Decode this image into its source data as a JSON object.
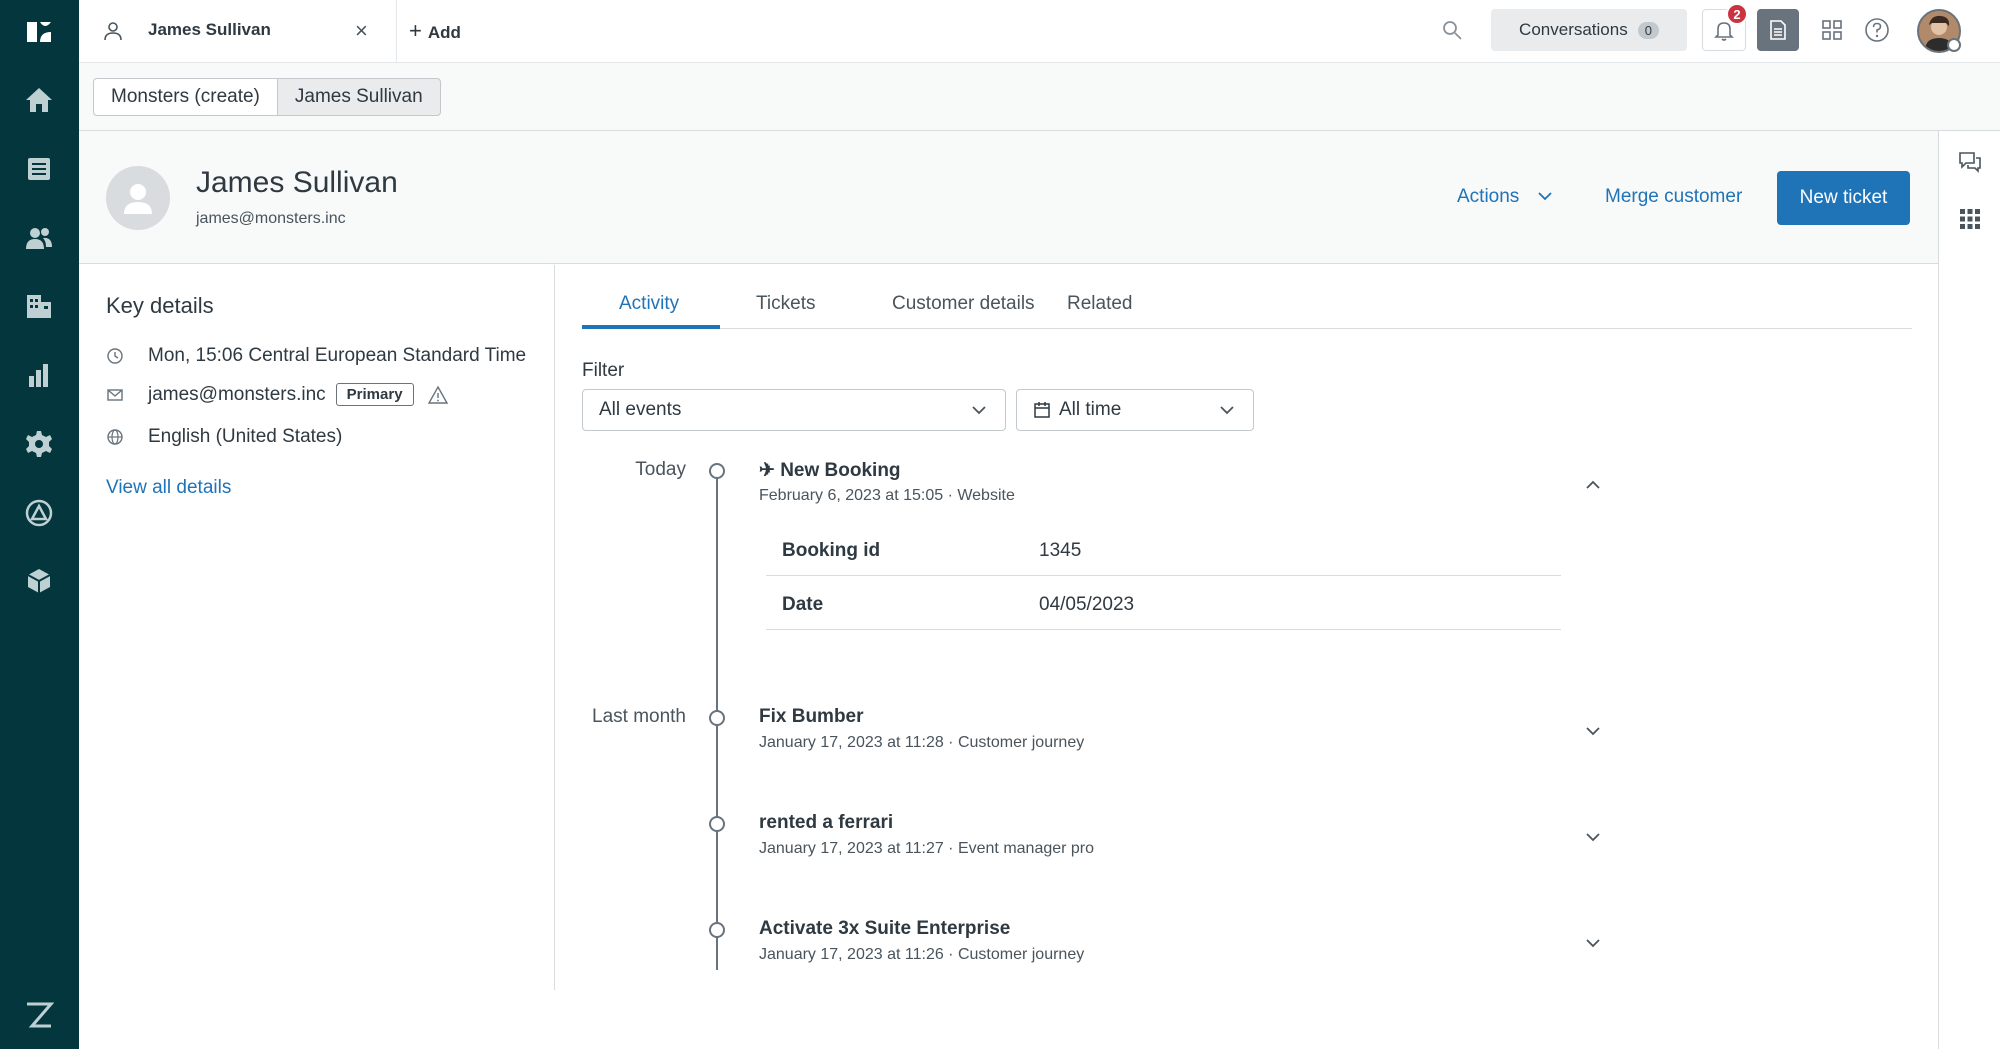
{
  "topbar": {
    "tab_label": "James Sullivan",
    "add_label": "Add",
    "conversations_label": "Conversations",
    "conversations_count": "0",
    "notifications_count": "2"
  },
  "breadcrumb": {
    "items": [
      "Monsters (create)",
      "James Sullivan"
    ]
  },
  "customer": {
    "name": "James Sullivan",
    "email": "james@monsters.inc"
  },
  "header_actions": {
    "actions_label": "Actions",
    "merge_label": "Merge customer",
    "new_ticket_label": "New ticket"
  },
  "key_details": {
    "title": "Key details",
    "time": "Mon, 15:06 Central European Standard Time",
    "email": "james@monsters.inc",
    "primary_tag": "Primary",
    "language": "English (United States)",
    "view_all": "View all details"
  },
  "tabs": [
    "Activity",
    "Tickets",
    "Customer details",
    "Related"
  ],
  "filter": {
    "label": "Filter",
    "events_value": "All events",
    "time_value": "All time"
  },
  "timeline": {
    "group_today": "Today",
    "group_last_month": "Last month",
    "events": [
      {
        "title": "✈ New Booking",
        "sub": "February 6, 2023 at 15:05 · Website"
      },
      {
        "title": "Fix Bumber",
        "sub": "January 17, 2023 at 11:28 · Customer journey"
      },
      {
        "title": "rented a ferrari",
        "sub": "January 17, 2023 at 11:27 · Event manager pro"
      },
      {
        "title": "Activate 3x Suite Enterprise",
        "sub": "January 17, 2023 at 11:26 · Customer journey"
      }
    ],
    "booking_details": [
      {
        "key": "Booking id",
        "value": "1345"
      },
      {
        "key": "Date",
        "value": "04/05/2023"
      }
    ]
  },
  "colors": {
    "nav_bg": "#03363d",
    "accent": "#1f73b7",
    "badge_red": "#cc3340"
  }
}
